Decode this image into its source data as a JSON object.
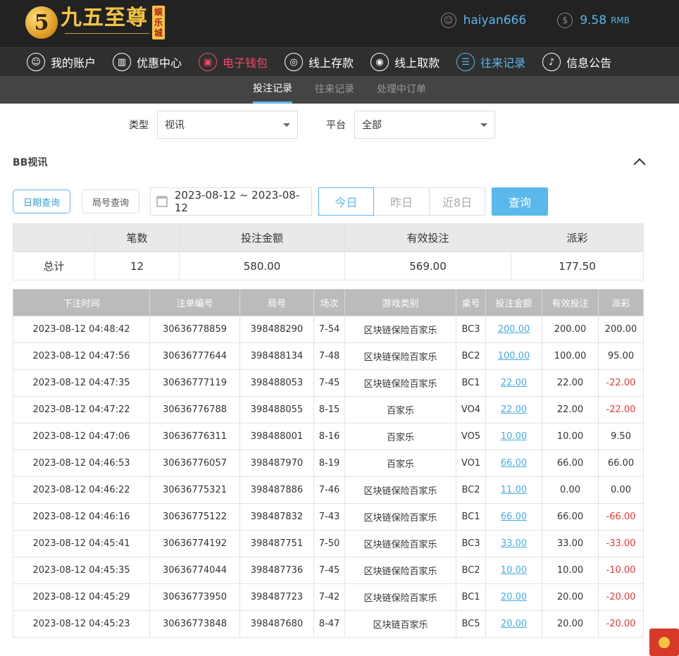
{
  "logo": {
    "mark": "5",
    "name": "九五至尊",
    "badge": [
      "娱",
      "乐",
      "城"
    ]
  },
  "user": {
    "name": "haiyan666",
    "balance": "9.58",
    "currency": "RMB"
  },
  "nav": [
    {
      "label": "我的账户",
      "icon": "user-icon"
    },
    {
      "label": "优惠中心",
      "icon": "gift-icon"
    },
    {
      "label": "电子钱包",
      "icon": "wallet-icon"
    },
    {
      "label": "线上存款",
      "icon": "deposit-icon"
    },
    {
      "label": "线上取款",
      "icon": "withdraw-icon"
    },
    {
      "label": "往来记录",
      "icon": "records-icon"
    },
    {
      "label": "信息公告",
      "icon": "bell-icon"
    }
  ],
  "subtabs": [
    "投注记录",
    "往来记录",
    "处理中订单"
  ],
  "filters": {
    "type_label": "类型",
    "type_value": "视讯",
    "platform_label": "平台",
    "platform_value": "全部"
  },
  "section_title": "BB视讯",
  "query": {
    "date_query": "日期查询",
    "round_query": "局号查询",
    "date_range": "2023-08-12 ~ 2023-08-12",
    "today": "今日",
    "yesterday": "昨日",
    "last8": "近8日",
    "search": "查询"
  },
  "summary": {
    "headers": [
      "",
      "笔数",
      "投注金额",
      "有效投注",
      "派彩"
    ],
    "row": [
      "总计",
      "12",
      "580.00",
      "569.00",
      "177.50"
    ]
  },
  "detail": {
    "headers": [
      "下注时间",
      "注单编号",
      "局号",
      "场次",
      "游戏类别",
      "桌号",
      "投注金额",
      "有效投注",
      "派彩"
    ],
    "rows": [
      [
        "2023-08-12 04:48:42",
        "30636778859",
        "398488290",
        "7-54",
        "区块链保险百家乐",
        "BC3",
        "200.00",
        "200.00",
        "200.00"
      ],
      [
        "2023-08-12 04:47:56",
        "30636777644",
        "398488134",
        "7-48",
        "区块链保险百家乐",
        "BC2",
        "100.00",
        "100.00",
        "95.00"
      ],
      [
        "2023-08-12 04:47:35",
        "30636777119",
        "398488053",
        "7-45",
        "区块链保险百家乐",
        "BC1",
        "22.00",
        "22.00",
        "-22.00"
      ],
      [
        "2023-08-12 04:47:22",
        "30636776788",
        "398488055",
        "8-15",
        "百家乐",
        "VO4",
        "22.00",
        "22.00",
        "-22.00"
      ],
      [
        "2023-08-12 04:47:06",
        "30636776311",
        "398488001",
        "8-16",
        "百家乐",
        "VO5",
        "10.00",
        "10.00",
        "9.50"
      ],
      [
        "2023-08-12 04:46:53",
        "30636776057",
        "398487970",
        "8-19",
        "百家乐",
        "VO1",
        "66.00",
        "66.00",
        "66.00"
      ],
      [
        "2023-08-12 04:46:22",
        "30636775321",
        "398487886",
        "7-46",
        "区块链保险百家乐",
        "BC2",
        "11.00",
        "0.00",
        "0.00"
      ],
      [
        "2023-08-12 04:46:16",
        "30636775122",
        "398487832",
        "7-43",
        "区块链保险百家乐",
        "BC1",
        "66.00",
        "66.00",
        "-66.00"
      ],
      [
        "2023-08-12 04:45:41",
        "30636774192",
        "398487751",
        "7-50",
        "区块链保险百家乐",
        "BC3",
        "33.00",
        "33.00",
        "-33.00"
      ],
      [
        "2023-08-12 04:45:35",
        "30636774044",
        "398487736",
        "7-45",
        "区块链保险百家乐",
        "BC2",
        "10.00",
        "10.00",
        "-10.00"
      ],
      [
        "2023-08-12 04:45:29",
        "30636773950",
        "398487723",
        "7-42",
        "区块链保险百家乐",
        "BC1",
        "20.00",
        "20.00",
        "-20.00"
      ],
      [
        "2023-08-12 04:45:23",
        "30636773848",
        "398487680",
        "8-47",
        "区块链百家乐",
        "BC5",
        "20.00",
        "20.00",
        "-20.00"
      ]
    ]
  },
  "colors": {
    "accent": "#5ab8ea",
    "wallet_red": "#ef4b6b",
    "negative": "#e53935",
    "header_bg": "#222222"
  }
}
